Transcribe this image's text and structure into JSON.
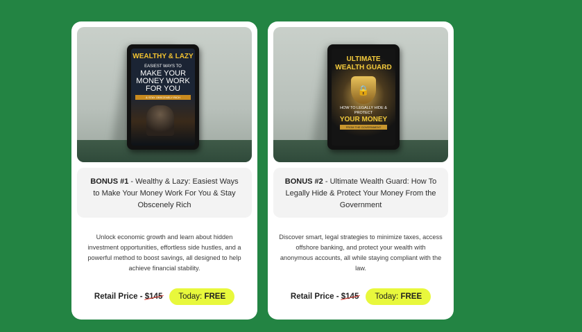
{
  "cards": [
    {
      "book": {
        "top": "WEALTHY & LAZY",
        "sub": "EASIEST WAYS TO",
        "main": "MAKE YOUR MONEY WORK FOR YOU",
        "tag": "& STAY OBSCENELY RICH"
      },
      "bonus_label": "BONUS #1",
      "title": " - Wealthy & Lazy: Easiest Ways to Make Your Money Work For You & Stay Obscenely Rich",
      "description": "Unlock economic growth and learn about hidden investment opportunities, effortless side hustles, and a powerful method to boost savings, all designed to help achieve financial stability.",
      "retail_label": "Retail Price - ",
      "retail_price": "$145",
      "today_label": "Today: ",
      "today_value": "FREE"
    },
    {
      "book": {
        "top": "ULTIMATE WEALTH GUARD",
        "sub": "HOW TO LEGALLY HIDE & PROTECT",
        "main": "YOUR MONEY",
        "tag": "FROM THE GOVERNMENT"
      },
      "bonus_label": "BONUS #2",
      "title": " - Ultimate Wealth Guard: How To Legally Hide & Protect Your Money From the Government",
      "description": "Discover smart, legal strategies to minimize taxes, access offshore banking, and protect your wealth with anonymous accounts, all while staying compliant with the law.",
      "retail_label": "Retail Price - ",
      "retail_price": "$145",
      "today_label": "Today: ",
      "today_value": "FREE"
    }
  ],
  "colors": {
    "page_background": "#238443",
    "card_background": "#ffffff",
    "badge_background": "#e8f83c",
    "strike_color": "#d9342b"
  }
}
